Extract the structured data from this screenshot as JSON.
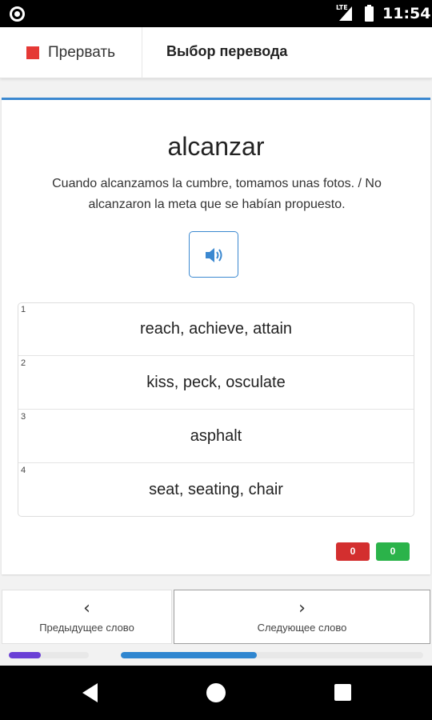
{
  "status_bar": {
    "time": "11:54",
    "network": "LTE"
  },
  "header": {
    "stop_label": "Прервать",
    "title": "Выбор перевода"
  },
  "card": {
    "word": "alcanzar",
    "example": "Cuando alcanzamos la cumbre, tomamos unas fotos. / No alcanzaron la meta que se habían propuesto.",
    "options": [
      {
        "num": "1",
        "text": "reach, achieve, attain"
      },
      {
        "num": "2",
        "text": "kiss, peck, osculate"
      },
      {
        "num": "3",
        "text": "asphalt"
      },
      {
        "num": "4",
        "text": "seat, seating, chair"
      }
    ],
    "score": {
      "wrong": "0",
      "right": "0"
    }
  },
  "nav": {
    "prev_label": "Предыдущее слово",
    "next_label": "Следующее слово",
    "prev_icon": "chevron-left-icon",
    "next_icon": "chevron-right-icon"
  },
  "progress": {
    "session": 0.4,
    "words": 0.45
  },
  "colors": {
    "accent": "#3b88d0",
    "stop": "#e53935",
    "wrong": "#d32f2f",
    "right": "#2bb34a",
    "progress_session": "#6a3fd6",
    "progress_words": "#2f86d0"
  }
}
